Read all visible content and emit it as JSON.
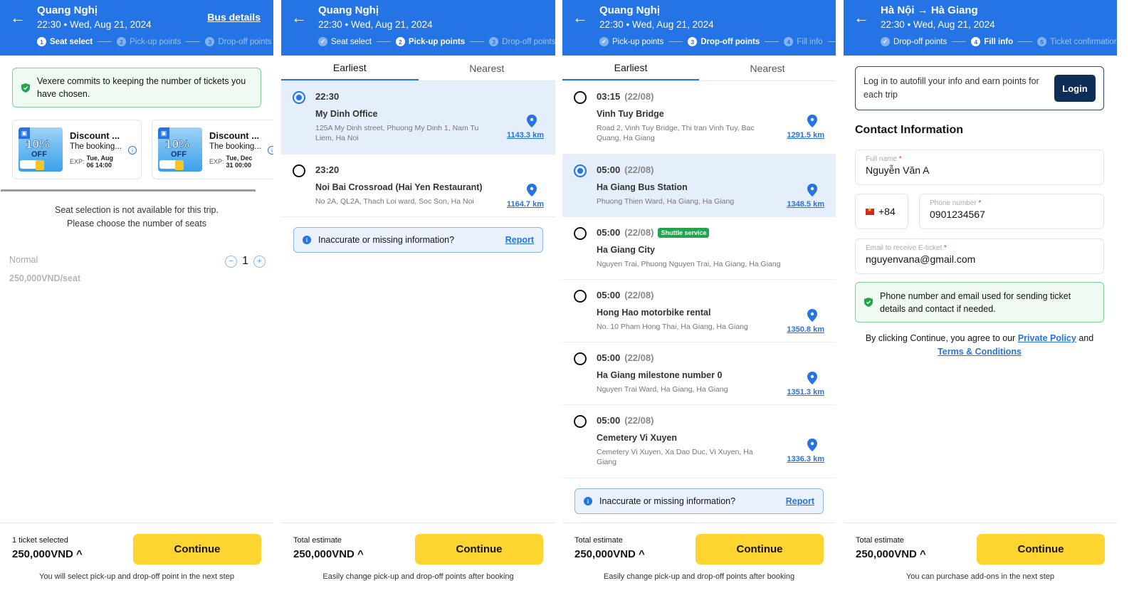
{
  "colors": {
    "brand": "#2474e5",
    "accent": "#fed431",
    "success": "#23a34d",
    "dark": "#0d2e59"
  },
  "panel1": {
    "header": {
      "title": "Quang Nghị",
      "subtitle": "22:30 • Wed, Aug 21, 2024",
      "bus_details": "Bus details",
      "steps": [
        {
          "num": "1",
          "label": "Seat select"
        },
        {
          "num": "2",
          "label": "Pick-up points"
        },
        {
          "num": "3",
          "label": "Drop-off points"
        }
      ]
    },
    "notice": "Vexere commits to keeping the number of tickets you have chosen.",
    "vouchers": [
      {
        "badge": "10%",
        "off": "OFF",
        "title": "Discount ...",
        "desc": "The booking...",
        "exp_label": "EXP:",
        "exp_date": "Tue, Aug",
        "exp_time": "06 14:00"
      },
      {
        "badge": "10%",
        "off": "OFF",
        "title": "Discount ...",
        "desc": "The booking...",
        "exp_label": "EXP:",
        "exp_date": "Tue, Dec",
        "exp_time": "31 00:00"
      }
    ],
    "seat_msg_1": "Seat selection is not available for this trip.",
    "seat_msg_2": "Please choose the number of seats",
    "seat_type": "Normal",
    "seat_price": "250,000VND/seat",
    "quantity": "1",
    "minus": "−",
    "plus": "+",
    "footer": {
      "label": "1 ticket selected",
      "amount": "250,000VND ^",
      "button": "Continue",
      "note": "You will select pick-up and drop-off point in the next step"
    }
  },
  "panel2": {
    "header": {
      "title": "Quang Nghị",
      "subtitle": "22:30 • Wed, Aug 21, 2024",
      "steps": [
        {
          "num": "✓",
          "label": "Seat select"
        },
        {
          "num": "2",
          "label": "Pick-up points"
        },
        {
          "num": "3",
          "label": "Drop-off points"
        }
      ]
    },
    "tabs": [
      "Earliest",
      "Nearest"
    ],
    "points": [
      {
        "time": "22:30",
        "name": "My Dinh Office",
        "address": "125A My Dinh street, Phuong My Dinh 1, Nam Tu Liem, Ha Noi",
        "distance": "1143.3 km",
        "selected": true
      },
      {
        "time": "23:20",
        "name": "Noi Bai Crossroad (Hai Yen Restaurant)",
        "address": "No 2A, QL2A, Thach Loi ward, Soc Son, Ha Noi",
        "distance": "1164.7 km",
        "selected": false
      }
    ],
    "report": {
      "text": "Inaccurate or missing information?",
      "link": "Report",
      "icon": "i"
    },
    "footer": {
      "label": "Total estimate",
      "amount": "250,000VND ^",
      "button": "Continue",
      "note": "Easily change pick-up and drop-off points after booking"
    }
  },
  "panel3": {
    "header": {
      "title": "Quang Nghị",
      "subtitle": "22:30 • Wed, Aug 21, 2024",
      "steps": [
        {
          "num": "✓",
          "label": "Pick-up points"
        },
        {
          "num": "3",
          "label": "Drop-off points"
        },
        {
          "num": "4",
          "label": "Fill info"
        }
      ]
    },
    "tabs": [
      "Earliest",
      "Nearest"
    ],
    "points": [
      {
        "time": "03:15",
        "date": "(22/08)",
        "name": "Vinh Tuy Bridge",
        "address": "Road 2, Vinh Tuy Bridge, Thi tran Vinh Tuy, Bac Quang, Ha Giang",
        "distance": "1291.5 km"
      },
      {
        "time": "05:00",
        "date": "(22/08)",
        "name": "Ha Giang Bus Station",
        "address": "Phuong Thien Ward, Ha Giang, Ha Giang",
        "distance": "1348.5 km"
      },
      {
        "time": "05:00",
        "date": "(22/08)",
        "badge": "Shuttle service",
        "name": "Ha Giang City",
        "address": "Nguyen Trai, Phuong Nguyen Trai, Ha Giang, Ha Giang"
      },
      {
        "time": "05:00",
        "date": "(22/08)",
        "name": "Hong Hao motorbike rental",
        "address": "No. 10 Pham Hong Thai, Ha Giang, Ha Giang",
        "distance": "1350.8 km"
      },
      {
        "time": "05:00",
        "date": "(22/08)",
        "name": "Ha Giang milestone number 0",
        "address": "Nguyen Trai Ward, Ha Giang, Ha Giang",
        "distance": "1351.3 km"
      },
      {
        "time": "05:00",
        "date": "(22/08)",
        "name": "Cemetery Vi Xuyen",
        "address": "Cemetery Vi Xuyen, Xa Dao Duc, Vi Xuyen, Ha Giang",
        "distance": "1336.3 km"
      }
    ],
    "report": {
      "text": "Inaccurate or missing information?",
      "link": "Report",
      "icon": "i"
    },
    "footer": {
      "label": "Total estimate",
      "amount": "250,000VND ^",
      "button": "Continue",
      "note": "Easily change pick-up and drop-off points after booking"
    }
  },
  "panel4": {
    "header": {
      "title": "Hà Nội → Hà Giang",
      "subtitle": "22:30 • Wed, Aug 21, 2024",
      "steps": [
        {
          "num": "✓",
          "label": "Drop-off points"
        },
        {
          "num": "4",
          "label": "Fill info"
        },
        {
          "num": "5",
          "label": "Ticket confirmation"
        }
      ]
    },
    "login_text": "Log in to autofill your info and earn points for each trip",
    "login_button": "Login",
    "section_title": "Contact Information",
    "full_name_label": "Full name",
    "full_name": "Nguyễn Văn A",
    "country_code": "+84",
    "phone_label": "Phone number",
    "phone": "0901234567",
    "email_label": "Email to receive E-ticket",
    "email": "nguyenvana@gmail.com",
    "required": "*",
    "notice": "Phone number and email used for sending ticket details and contact if needed.",
    "agree_prefix": "By clicking Continue, you agree to our",
    "privacy": "Private Policy",
    "and": "and",
    "terms": "Terms & Conditions",
    "footer": {
      "label": "Total estimate",
      "amount": "250,000VND ^",
      "button": "Continue",
      "note": "You can purchase add-ons in the next step"
    }
  }
}
